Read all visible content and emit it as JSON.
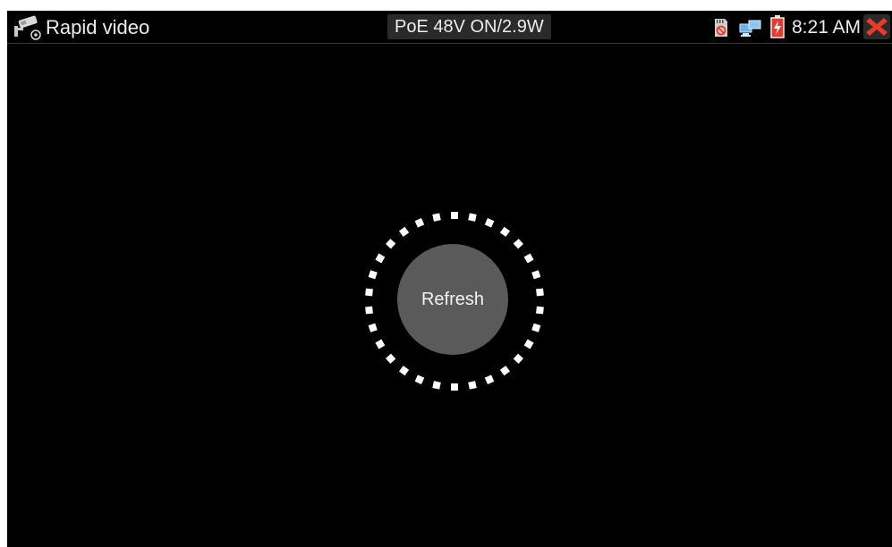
{
  "titlebar": {
    "app_icon": "camera-icon",
    "title": "Rapid video",
    "poe_status": "PoE 48V ON/2.9W"
  },
  "status": {
    "sd_icon": "sd-card-icon",
    "network_icon": "network-icon",
    "battery_icon": "battery-charging-icon",
    "time": "8:21 AM",
    "close_icon": "close-icon",
    "close_color": "#e53a2c"
  },
  "main": {
    "refresh_label": "Refresh",
    "button_color": "#5a5a5a",
    "spinner_color": "#ffffff"
  }
}
